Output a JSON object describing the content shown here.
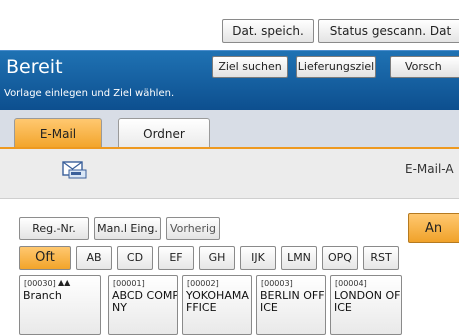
{
  "toolbar": {
    "save_label": "Dat. speich.",
    "status_label": "Status gescann. Dat"
  },
  "header": {
    "title": "Bereit",
    "subtitle": "Vorlage einlegen und Ziel wählen.",
    "search_dest_label": "Ziel suchen",
    "dest_list_label": "Lieferungsziel",
    "preview_label": "Vorsch"
  },
  "tabs": [
    {
      "label": "E-Mail"
    },
    {
      "label": "Ordner"
    }
  ],
  "destination": {
    "email_label": "E-Mail-A"
  },
  "controls": {
    "reg_nr_label": "Reg.-Nr.",
    "manual_entry_label": "Man.l Eing.",
    "previous_label": "Vorherig",
    "to_label": "An"
  },
  "index_tabs": [
    "Oft",
    "AB",
    "CD",
    "EF",
    "GH",
    "IJK",
    "LMN",
    "OPQ",
    "RST"
  ],
  "entries": [
    {
      "id": "[00030]",
      "name": "Branch"
    },
    {
      "id": "[00001]",
      "name": "ABCD COMPA\nNY"
    },
    {
      "id": "[00002]",
      "name": "YOKOHAMA O\nFFICE"
    },
    {
      "id": "[00003]",
      "name": "BERLIN OFF\nICE"
    },
    {
      "id": "[00004]",
      "name": "LONDON OFF\nICE"
    }
  ],
  "colors": {
    "title_bar": "#1565ac",
    "accent_orange": "#f2a42a"
  },
  "icons": {
    "envelope": "envelope-icon",
    "scanner": "scanner-icon"
  }
}
